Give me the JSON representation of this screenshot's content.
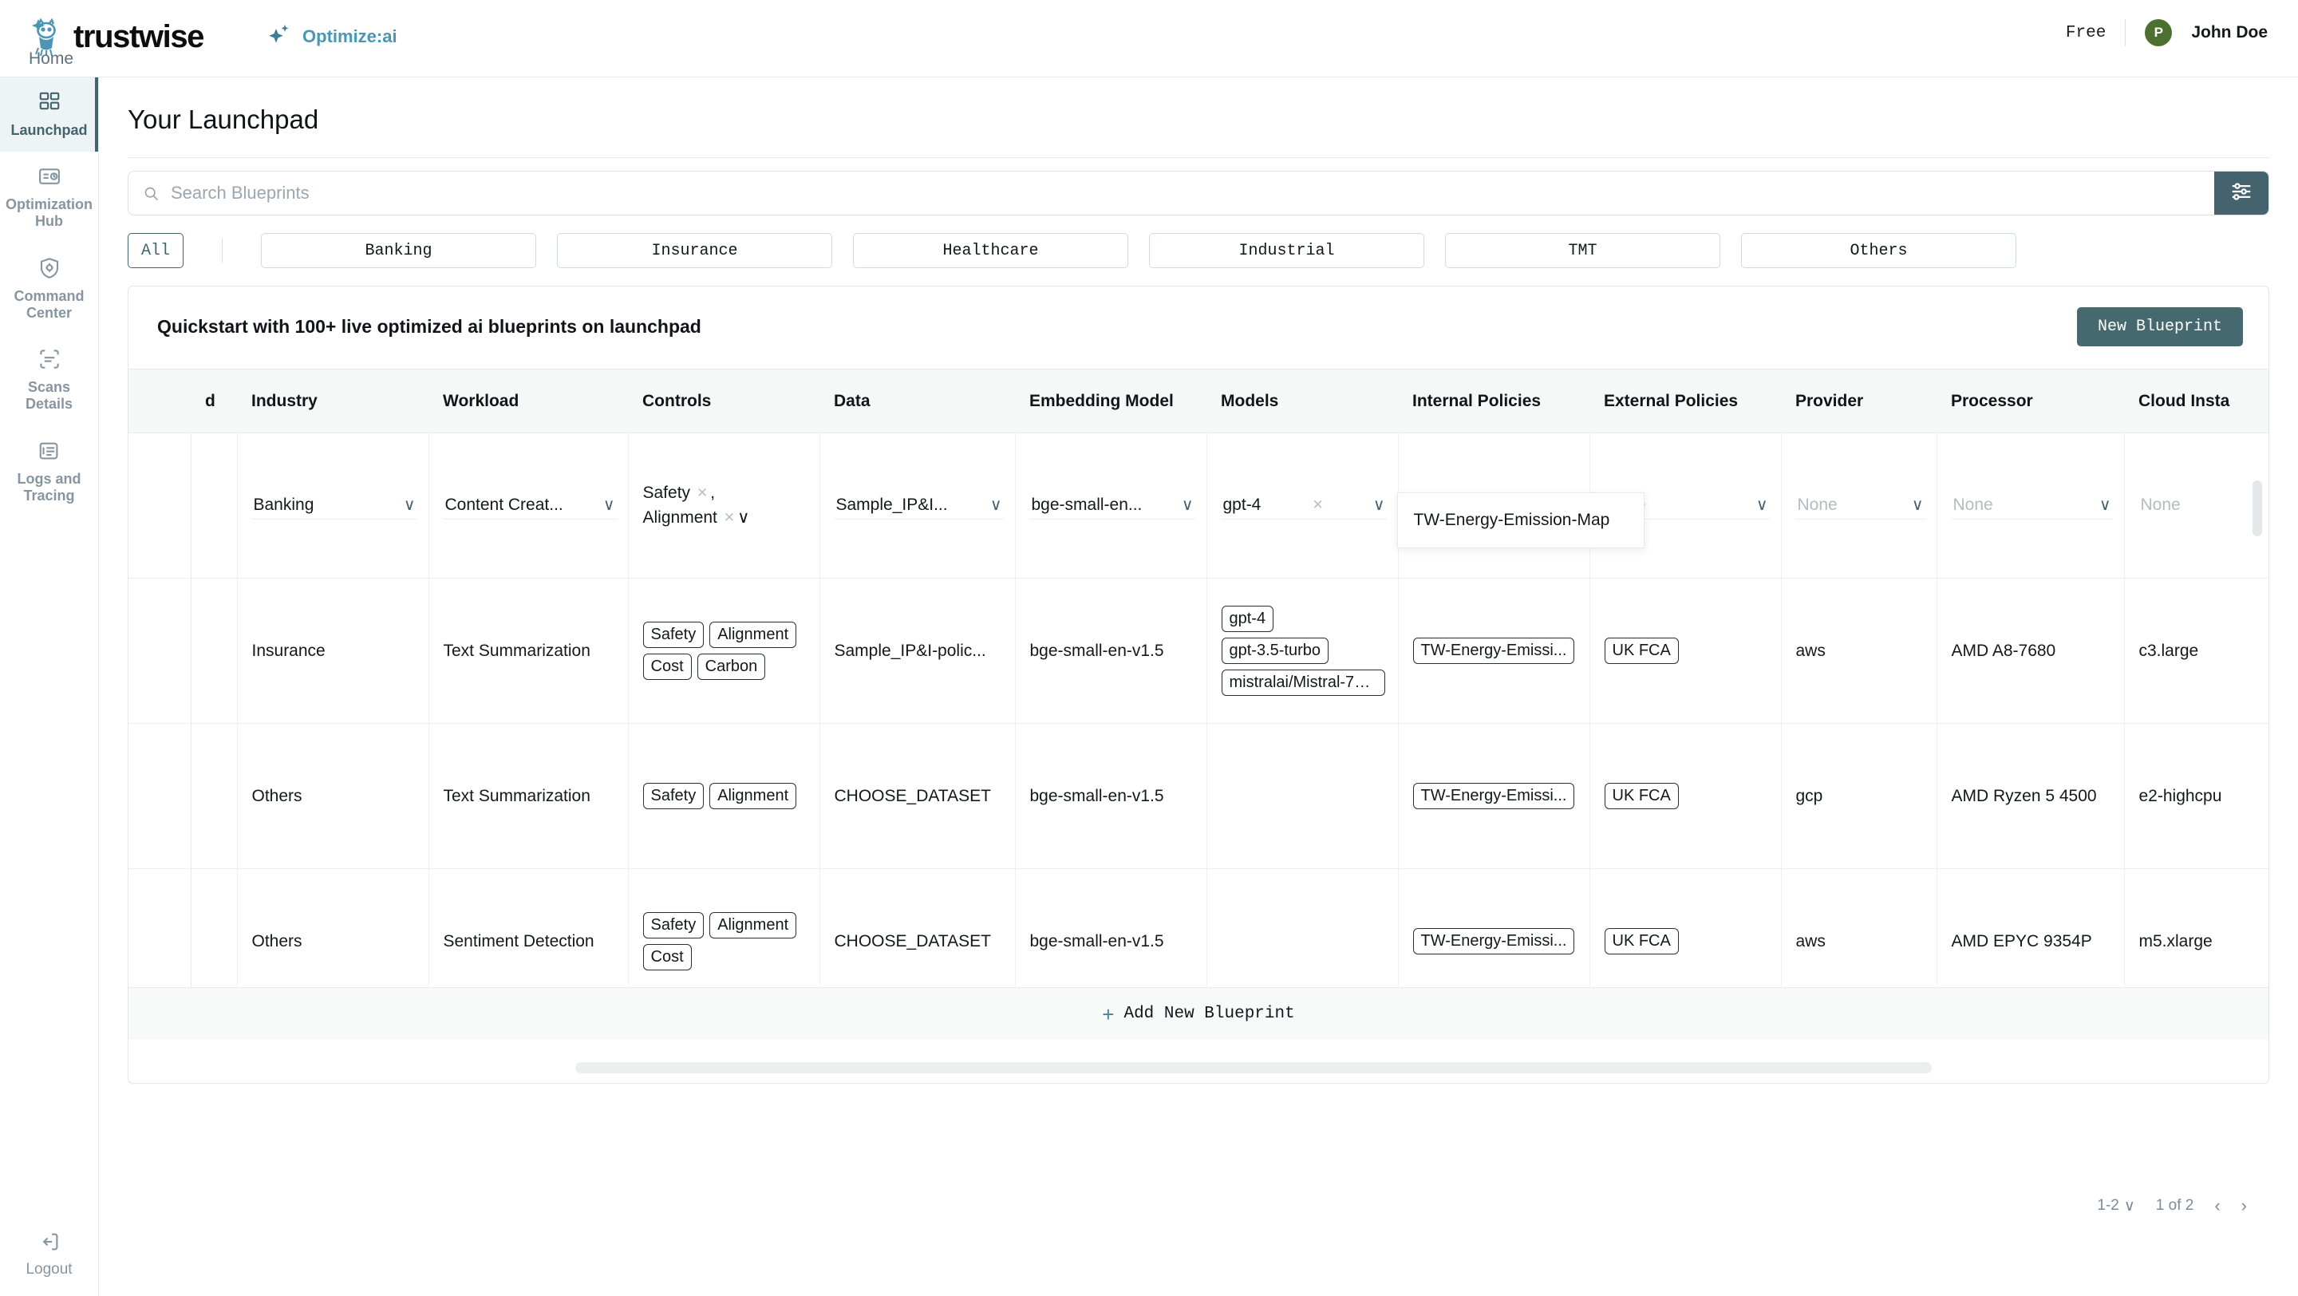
{
  "topbar": {
    "brand_name": "trustwise",
    "brand_icon": "owl-logo-icon",
    "product_icon": "sparkle-icon",
    "product_name": "Optimize:ai",
    "plan": "Free",
    "avatar_initial": "P",
    "username": "John Doe",
    "home_link": "Home"
  },
  "sidebar": {
    "items": [
      {
        "label": "Launchpad",
        "icon": "grid-icon",
        "active": true
      },
      {
        "label": "Optimization Hub",
        "icon": "report-clock-icon",
        "active": false
      },
      {
        "label": "Command Center",
        "icon": "shield-gear-icon",
        "active": false
      },
      {
        "label": "Scans Details",
        "icon": "scan-icon",
        "active": false
      },
      {
        "label": "Logs and Tracing",
        "icon": "logs-icon",
        "active": false
      }
    ],
    "logout": {
      "label": "Logout",
      "icon": "logout-icon"
    }
  },
  "page": {
    "title": "Your Launchpad"
  },
  "search": {
    "placeholder": "Search Blueprints",
    "value": "",
    "icon": "search-icon",
    "filter_icon": "sliders-icon"
  },
  "tabs": {
    "selected": "All",
    "items": [
      "All",
      "Banking",
      "Insurance",
      "Healthcare",
      "Industrial",
      "TMT",
      "Others"
    ]
  },
  "card": {
    "heading": "Quickstart with 100+ live optimized ai blueprints on launchpad",
    "new_blueprint_label": "New Blueprint",
    "add_row_label": "Add New Blueprint",
    "add_row_icon": "plus-icon"
  },
  "table": {
    "columns": [
      "d",
      "Industry",
      "Workload",
      "Controls",
      "Data",
      "Embedding Model",
      "Models",
      "Internal Policies",
      "External Policies",
      "Provider",
      "Processor",
      "Cloud Insta"
    ],
    "editable_row": {
      "industry": "Banking",
      "workload": "Content Creat...",
      "controls": [
        "Safety",
        "Alignment"
      ],
      "data": "Sample_IP&I...",
      "embedding_model": "bge-small-en...",
      "models": [
        "gpt-4"
      ],
      "internal_policies_placeholder": "None",
      "external_policies_placeholder": "None",
      "provider_placeholder": "None",
      "processor_placeholder": "None",
      "cloud_instance_placeholder": "None"
    },
    "open_dropdown": {
      "options": [
        "TW-Energy-Emission-Map"
      ]
    },
    "rows": [
      {
        "industry": "Insurance",
        "workload": "Text Summarization",
        "controls": [
          "Safety",
          "Alignment",
          "Cost",
          "Carbon"
        ],
        "data": "Sample_IP&I-polic...",
        "embedding_model": "bge-small-en-v1.5",
        "models": [
          "gpt-4",
          "gpt-3.5-turbo",
          "mistralai/Mistral-7B..."
        ],
        "internal_policies": [
          "TW-Energy-Emissi..."
        ],
        "external_policies": [
          "UK FCA"
        ],
        "provider": "aws",
        "processor": "AMD A8-7680",
        "cloud_instance": "c3.large"
      },
      {
        "industry": "Others",
        "workload": "Text Summarization",
        "controls": [
          "Safety",
          "Alignment"
        ],
        "data": "CHOOSE_DATASET",
        "embedding_model": "bge-small-en-v1.5",
        "models": [],
        "internal_policies": [
          "TW-Energy-Emissi..."
        ],
        "external_policies": [
          "UK FCA"
        ],
        "provider": "gcp",
        "processor": "AMD Ryzen 5 4500",
        "cloud_instance": "e2-highcpu"
      },
      {
        "industry": "Others",
        "workload": "Sentiment Detection",
        "controls": [
          "Safety",
          "Alignment",
          "Cost"
        ],
        "data": "CHOOSE_DATASET",
        "embedding_model": "bge-small-en-v1.5",
        "models": [],
        "internal_policies": [
          "TW-Energy-Emissi..."
        ],
        "external_policies": [
          "UK FCA"
        ],
        "provider": "aws",
        "processor": "AMD EPYC 9354P",
        "cloud_instance": "m5.xlarge"
      }
    ]
  },
  "pagination": {
    "rows_per_page": "1-2",
    "page_status": "1 of 2",
    "prev_icon": "chevron-left-icon",
    "next_icon": "chevron-right-icon"
  },
  "colors": {
    "accent": "#44636e",
    "brand_blue": "#4a96b3",
    "avatar_green": "#4c7030",
    "header_bg": "#f6f8f8"
  }
}
